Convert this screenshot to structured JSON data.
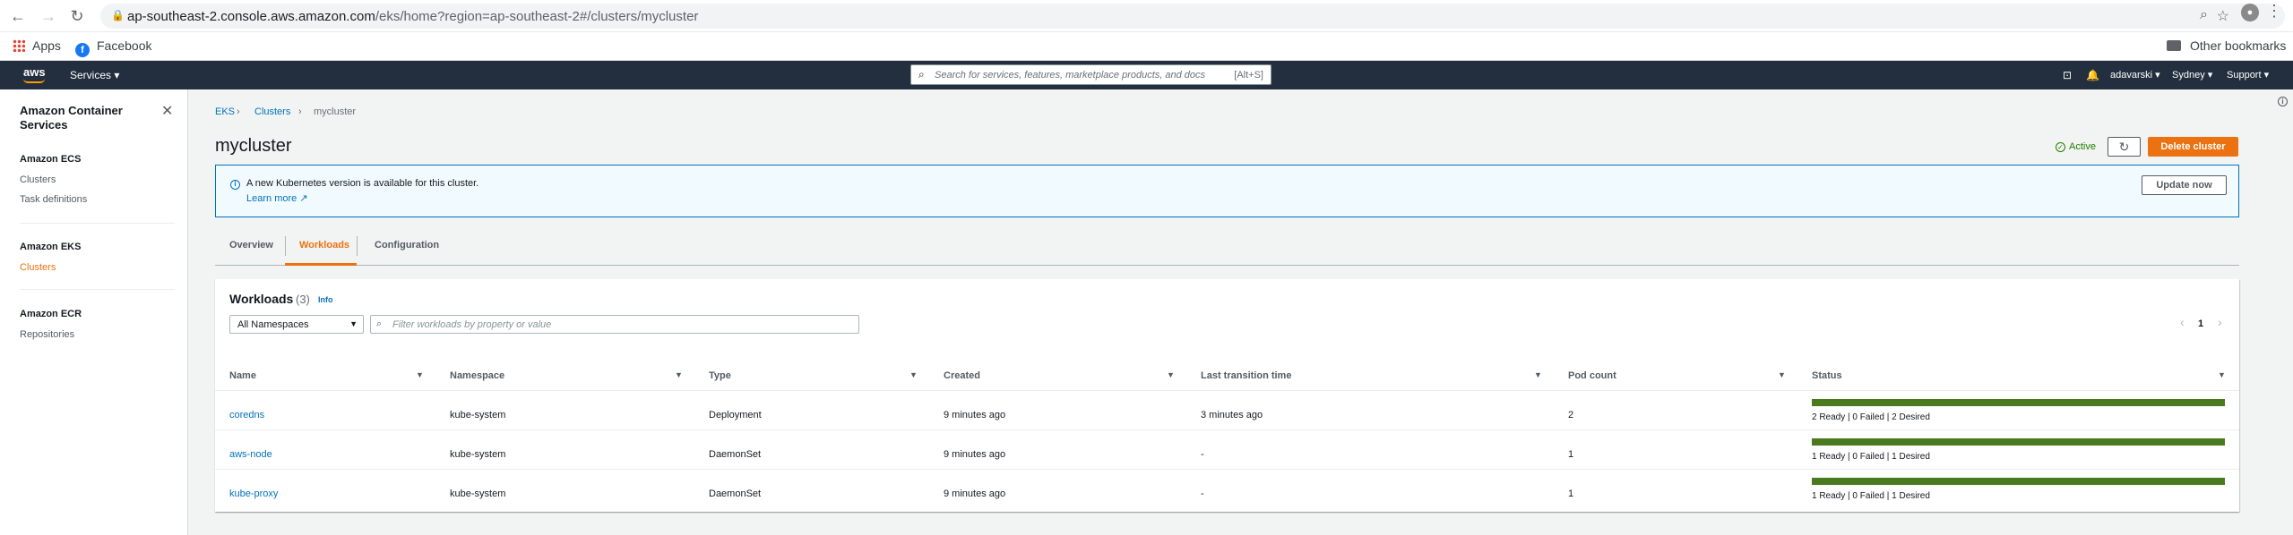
{
  "browser": {
    "url_host": "ap-southeast-2.console.aws.amazon.com",
    "url_path": "/eks/home?region=ap-southeast-2#/clusters/mycluster",
    "bookmarks": [
      "Apps",
      "Facebook"
    ],
    "other_bookmarks": "Other bookmarks"
  },
  "aws_nav": {
    "logo": "aws",
    "services": "Services ▾",
    "search_placeholder": "Search for services, features, marketplace products, and docs",
    "search_shortcut": "[Alt+S]",
    "user": "adavarski ▾",
    "region": "Sydney ▾",
    "support": "Support ▾"
  },
  "sidebar": {
    "title": "Amazon Container Services",
    "sections": [
      {
        "heading": "Amazon ECS",
        "items": [
          "Clusters",
          "Task definitions"
        ]
      },
      {
        "heading": "Amazon EKS",
        "items": [
          "Clusters"
        ]
      },
      {
        "heading": "Amazon ECR",
        "items": [
          "Repositories"
        ]
      }
    ]
  },
  "breadcrumb": [
    "EKS",
    "Clusters",
    "mycluster"
  ],
  "page": {
    "title": "mycluster",
    "status": "Active",
    "delete_button": "Delete cluster"
  },
  "banner": {
    "message": "A new Kubernetes version is available for this cluster.",
    "link": "Learn more",
    "button": "Update now"
  },
  "tabs": [
    "Overview",
    "Workloads",
    "Configuration"
  ],
  "active_tab": "Workloads",
  "workloads": {
    "title": "Workloads",
    "count": "(3)",
    "info": "Info",
    "namespace_select": "All Namespaces",
    "filter_placeholder": "Filter workloads by property or value",
    "page": "1",
    "columns": [
      "Name",
      "Namespace",
      "Type",
      "Created",
      "Last transition time",
      "Pod count",
      "Status"
    ],
    "rows": [
      {
        "name": "coredns",
        "namespace": "kube-system",
        "type": "Deployment",
        "created": "9 minutes ago",
        "last_transition": "3 minutes ago",
        "pod_count": "2",
        "status": "2 Ready | 0 Failed | 2 Desired",
        "ready_fraction": 1.0
      },
      {
        "name": "aws-node",
        "namespace": "kube-system",
        "type": "DaemonSet",
        "created": "9 minutes ago",
        "last_transition": "-",
        "pod_count": "1",
        "status": "1 Ready | 0 Failed | 1 Desired",
        "ready_fraction": 1.0
      },
      {
        "name": "kube-proxy",
        "namespace": "kube-system",
        "type": "DaemonSet",
        "created": "9 minutes ago",
        "last_transition": "-",
        "pod_count": "1",
        "status": "1 Ready | 0 Failed | 1 Desired",
        "ready_fraction": 1.0
      }
    ]
  },
  "colors": {
    "aws_nav_bg": "#232f3e",
    "accent_orange": "#ec7211",
    "link_blue": "#0073bb",
    "status_green": "#4a7a1f"
  }
}
